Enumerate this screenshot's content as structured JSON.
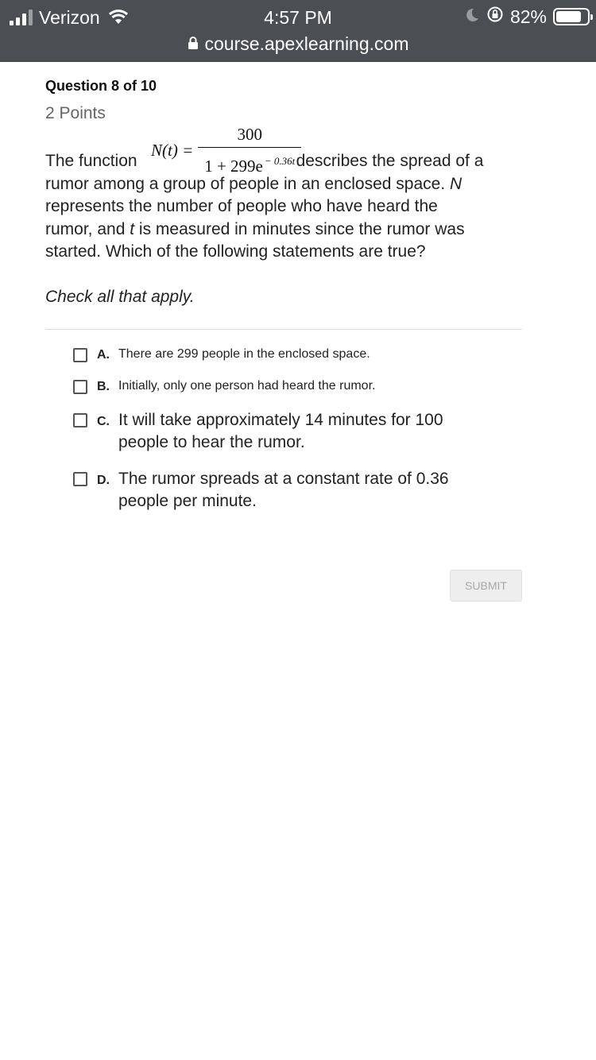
{
  "status_bar": {
    "carrier": "Verizon",
    "time": "4:57 PM",
    "battery": "82%",
    "url": "course.apexlearning.com"
  },
  "question": {
    "title": "Question 8 of 10",
    "points": "2 Points",
    "formula": {
      "lhs": "N(t) =",
      "numerator": "300",
      "denominator": "1 + 299e",
      "exponent": "− 0.36t"
    },
    "text_before": "The function",
    "text_after": "describes the spread of a",
    "line2a": "rumor among a group of people in an enclosed space.",
    "line2b": "N",
    "line3": "represents the number of people who have heard the",
    "line4a": "rumor, and",
    "line4b": "t",
    "line4c": "is measured in minutes since the rumor was",
    "line5": "started. Which of the following statements are true?",
    "instruction": "Check all that apply."
  },
  "options": [
    {
      "letter": "A.",
      "text": "There are 299 people in the enclosed space."
    },
    {
      "letter": "B.",
      "text": "Initially, only one person had heard the rumor."
    },
    {
      "letter": "C.",
      "line1": "It will take approximately 14 minutes for 100",
      "line2": "people to hear the rumor."
    },
    {
      "letter": "D.",
      "line1": "The rumor spreads at a constant rate of 0.36",
      "line2": "people per minute."
    }
  ],
  "submit_label": "SUBMIT"
}
